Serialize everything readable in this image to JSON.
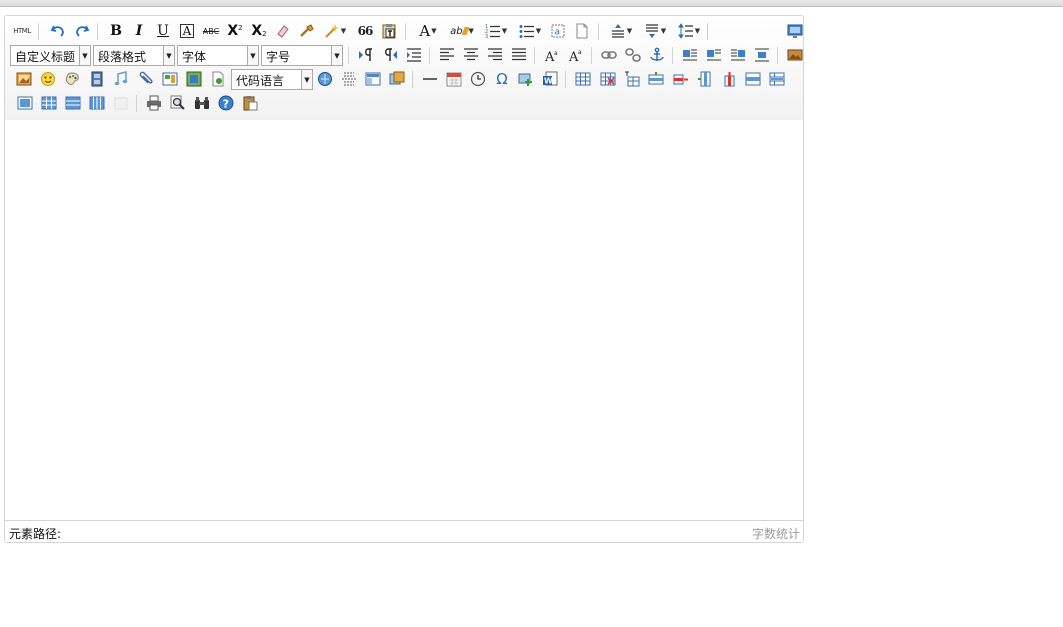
{
  "toolbar": {
    "row1": {
      "html_label": "HTML",
      "bold_glyph": "B",
      "italic_glyph": "I",
      "underline_glyph": "U",
      "fontborder_glyph": "A",
      "strike_glyph": "ABC",
      "superscript_glyph": "X",
      "superscript_mark": "2",
      "subscript_glyph": "X",
      "subscript_mark": "2",
      "quote_glyph": "66",
      "forecolor_glyph": "A",
      "backcolor_glyph": "ab"
    },
    "row2": {
      "custom_style": "自定义标题",
      "paragraph": "段落格式",
      "font_family": "字体",
      "font_size": "字号"
    },
    "row3": {
      "code_language": "代码语言",
      "special_char_glyph": "Ω"
    }
  },
  "status": {
    "path_label": "元素路径:",
    "word_count": "字数统计"
  }
}
